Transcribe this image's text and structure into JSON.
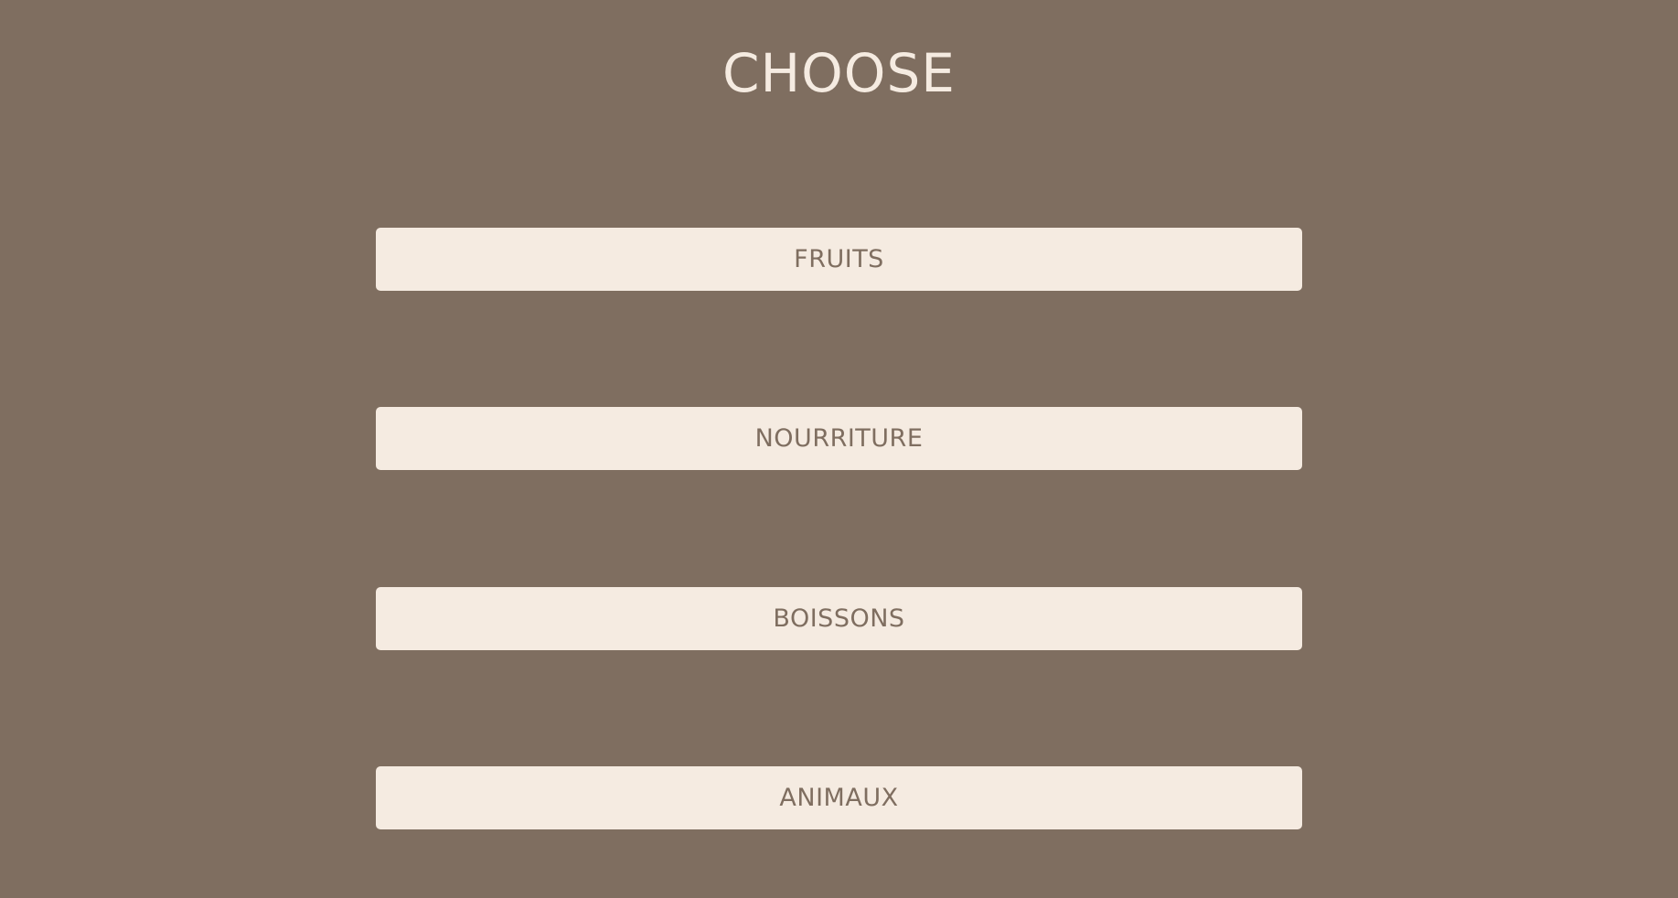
{
  "page": {
    "title": "CHOOSE"
  },
  "colors": {
    "background": "#7f6e60",
    "button_background": "#f5ebe1",
    "button_text": "#7f6e60",
    "title_text": "#f5ebe1"
  },
  "categories": [
    {
      "label": "FRUITS"
    },
    {
      "label": "NOURRITURE"
    },
    {
      "label": "BOISSONS"
    },
    {
      "label": "ANIMAUX"
    }
  ]
}
